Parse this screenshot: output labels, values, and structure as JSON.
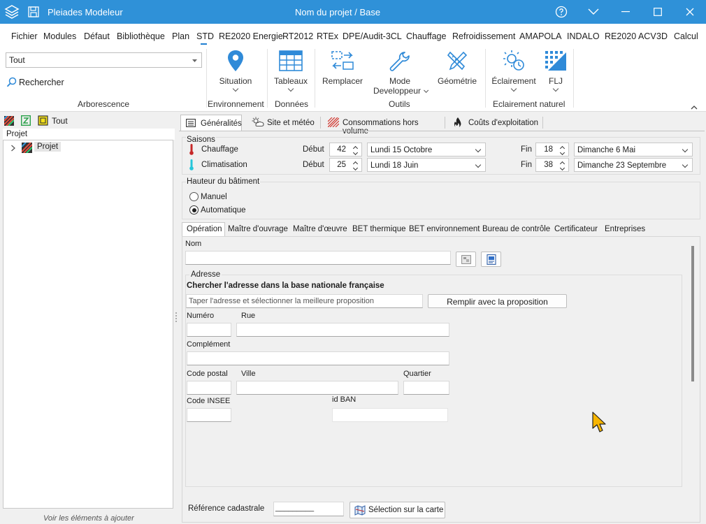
{
  "window": {
    "app_title": "Pleiades Modeleur",
    "doc_title": "Nom du projet / Base"
  },
  "menu": [
    "Fichier",
    "Modules",
    "Défaut",
    "Bibliothèque",
    "Plan",
    "STD",
    "RE2020 Energie",
    "RT2012",
    "RTEx",
    "DPE/Audit-3CL",
    "Chauffage",
    "Refroidissement",
    "AMAPOLA",
    "INDALO",
    "RE2020 ACV",
    "3D",
    "Calcul"
  ],
  "ribbon": {
    "filter_value": "Tout",
    "search_label": "Rechercher",
    "group_arbo": "Arborescence",
    "situation": "Situation",
    "group_env": "Environnement",
    "tableaux": "Tableaux",
    "group_donnees": "Données",
    "remplacer": "Remplacer",
    "mode_dev_1": "Mode",
    "mode_dev_2": "Developpeur",
    "geometrie": "Géométrie",
    "group_outils": "Outils",
    "eclairement": "Éclairement",
    "flj": "FLJ",
    "group_eclairement": "Eclairement naturel"
  },
  "tree": {
    "toolbar_label": "Tout",
    "header": "Projet",
    "root_item": "Projet",
    "footer": "Voir les éléments à ajouter"
  },
  "main_tabs": [
    "Généralités",
    "Site et météo",
    "Consommations hors volume",
    "Coûts d'exploitation"
  ],
  "saisons": {
    "title": "Saisons",
    "debut_label": "Début",
    "fin_label": "Fin",
    "chauffage": {
      "label": "Chauffage",
      "debut_week": "42",
      "debut_date": "Lundi 15 Octobre",
      "fin_week": "18",
      "fin_date": "Dimanche 6 Mai"
    },
    "climatisation": {
      "label": "Climatisation",
      "debut_week": "25",
      "debut_date": "Lundi 18 Juin",
      "fin_week": "38",
      "fin_date": "Dimanche 23 Septembre"
    }
  },
  "hauteur": {
    "title": "Hauteur du bâtiment",
    "manuel": "Manuel",
    "automatique": "Automatique",
    "selected": "Automatique"
  },
  "sub_tabs": [
    "Opération",
    "Maître d'ouvrage",
    "Maître d'œuvre",
    "BET thermique",
    "BET environnement",
    "Bureau de contrôle",
    "Certificateur",
    "Entreprises"
  ],
  "operation": {
    "nom_label": "Nom",
    "nom_value": "",
    "adresse_title": "Adresse",
    "search_heading": "Chercher l'adresse dans la base nationale française",
    "search_placeholder": "Taper l'adresse et sélectionner la meilleure proposition",
    "fill_button": "Remplir avec la proposition",
    "numero": "Numéro",
    "rue": "Rue",
    "complement": "Complément",
    "code_postal": "Code postal",
    "ville": "Ville",
    "quartier": "Quartier",
    "code_insee": "Code INSEE",
    "id_ban": "id BAN",
    "ref_cadastrale": "Référence cadastrale",
    "ref_value": "_________",
    "map_button": "Sélection sur la carte"
  },
  "colors": {
    "title_bar": "#2f91d8",
    "accent": "#1f7fd1",
    "icon_blue": "#2f8ad8"
  }
}
